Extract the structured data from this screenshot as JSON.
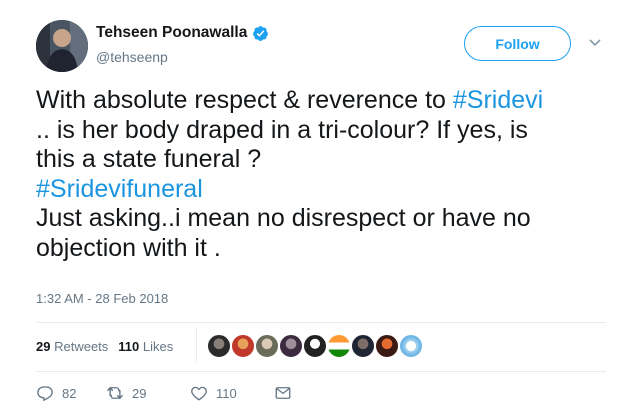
{
  "author": {
    "name": "Tehseen Poonawalla",
    "handle": "@tehseenp",
    "verified": true
  },
  "follow_label": "Follow",
  "tweet": {
    "line1": "With absolute respect & reverence to ",
    "hashtag1": "#Sridevi",
    "line2": ".. is her body draped in a tri-colour? If yes, is",
    "line3": "this a state funeral ?",
    "hashtag2": "#Sridevifuneral",
    "line4": "Just asking..i mean no disrespect or have no",
    "line5": "objection with it ."
  },
  "timestamp": "1:32 AM - 28 Feb 2018",
  "stats": {
    "retweets_count": "29",
    "retweets_label": "Retweets",
    "likes_count": "110",
    "likes_label": "Likes"
  },
  "actions": {
    "reply_count": "82",
    "retweet_count": "29",
    "like_count": "110"
  },
  "colors": {
    "accent": "#1da1f2",
    "hashtag": "#1b95e0",
    "muted": "#657786",
    "text": "#14171a"
  },
  "icons": [
    "verified-icon",
    "caret-down-icon",
    "reply-icon",
    "retweet-icon",
    "heart-icon",
    "message-icon"
  ]
}
